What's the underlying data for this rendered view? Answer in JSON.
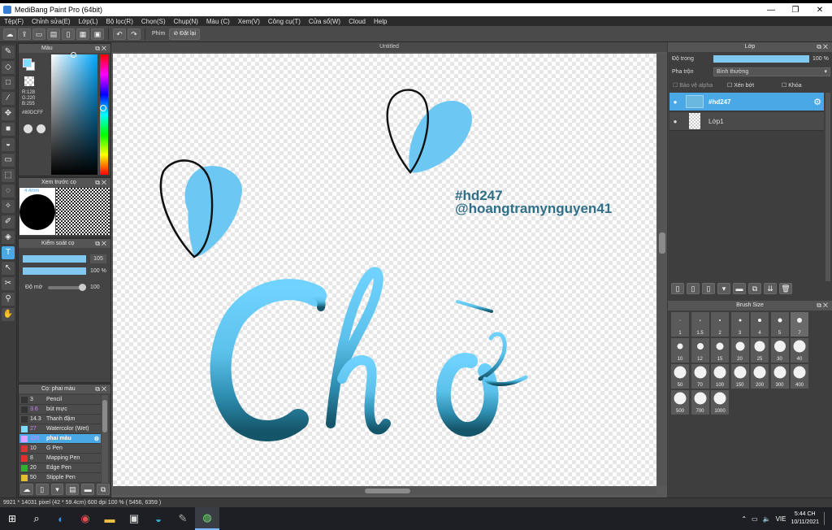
{
  "window": {
    "title": "MediBang Paint Pro (64bit)",
    "minimize": "—",
    "maximize": "❐",
    "close": "✕"
  },
  "menu": [
    "Tệp(F)",
    "Chỉnh sửa(E)",
    "Lớp(L)",
    "Bộ lọc(R)",
    "Chọn(S)",
    "Chụp(N)",
    "Màu (C)",
    "Xem(V)",
    "Công cụ(T)",
    "Cửa sổ(W)",
    "Cloud",
    "Help"
  ],
  "toolbar": {
    "phim_label": "Phím",
    "reset_label": "Đặt lại"
  },
  "color_panel": {
    "title": "Màu",
    "r": "R:128",
    "g": "G:220",
    "b": "B:255",
    "hex": "#80DCFF",
    "fg_color": "#80DCFF"
  },
  "brush_preview": {
    "title": "Xem trước cọ",
    "size_label": "4.4mm"
  },
  "brush_control": {
    "title": "Kiểm soát cọ",
    "size_value": "105",
    "opacity_value": "100 %",
    "blur_label": "Độ mờ",
    "blur_value": "100"
  },
  "brush_list": {
    "title": "Cọ: phai màu",
    "items": [
      {
        "size": "3",
        "name": "Pencil",
        "color": "#333333"
      },
      {
        "size": "3.6",
        "name": "bút mực",
        "color": "#333333"
      },
      {
        "size": "14.3",
        "name": "Thanh đậm",
        "color": "#333333"
      },
      {
        "size": "27",
        "name": "Watercolor (Wet)",
        "color": "#80dcff"
      },
      {
        "size": "105",
        "name": "phai màu",
        "color": "#d9a0ff"
      },
      {
        "size": "10",
        "name": "G Pen",
        "color": "#e03030"
      },
      {
        "size": "8",
        "name": "Mapping Pen",
        "color": "#e03030"
      },
      {
        "size": "20",
        "name": "Edge Pen",
        "color": "#30b030"
      },
      {
        "size": "50",
        "name": "Stipple Pen",
        "color": "#e0c030"
      }
    ]
  },
  "document": {
    "tab_title": "Untitled"
  },
  "canvas_text": {
    "line1": "#hd247",
    "line2": "@hoangtramynguyen41",
    "main_word": "Chờ"
  },
  "layer_panel": {
    "title": "Lớp",
    "opacity_label": "Độ trong",
    "opacity_value": "100 %",
    "opacity_fraction": 1.0,
    "blend_label": "Pha trộn",
    "blend_value": "Bình thường",
    "protect_alpha": "Bảo vệ alpha",
    "clip": "Xén bớt",
    "lock": "Khóa",
    "layers": [
      {
        "name": "#hd247",
        "selected": true
      },
      {
        "name": "Lớp1",
        "selected": false
      }
    ]
  },
  "brush_size_panel": {
    "title": "Brush Size",
    "sizes": [
      "1",
      "1.5",
      "2",
      "3",
      "4",
      "5",
      "7",
      "10",
      "12",
      "15",
      "20",
      "25",
      "30",
      "40",
      "50",
      "70",
      "100",
      "150",
      "200",
      "300",
      "400",
      "500",
      "700",
      "1000"
    ]
  },
  "status": {
    "text": "9921 * 14031 pixel  (42 * 59.4cm)  600 dpi  100 %  ( 5456, 6359 )"
  },
  "taskbar": {
    "lang": "VIE",
    "time": "5:44 CH",
    "date": "10/11/2021"
  }
}
